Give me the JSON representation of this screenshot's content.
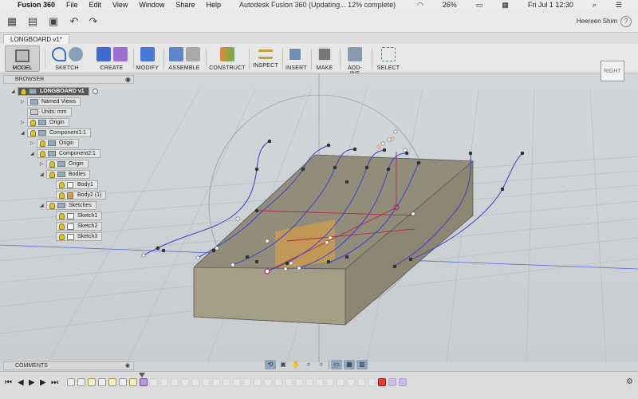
{
  "menubar": {
    "app": "Fusion 360",
    "items": [
      "File",
      "Edit",
      "View",
      "Window",
      "Share",
      "Help"
    ],
    "window_title": "Autodesk Fusion 360  (Updating... 12% complete)",
    "battery": "26%",
    "datetime": "Fri Jul 1  12:30"
  },
  "toolbar": {
    "user": "Heereen Shim"
  },
  "document_tab": "LONGBOARD v1*",
  "ribbon": {
    "workspace": "MODEL",
    "groups": [
      {
        "label": "SKETCH"
      },
      {
        "label": "CREATE"
      },
      {
        "label": "MODIFY"
      },
      {
        "label": "ASSEMBLE"
      },
      {
        "label": "CONSTRUCT"
      },
      {
        "label": "INSPECT"
      },
      {
        "label": "INSERT"
      },
      {
        "label": "MAKE"
      },
      {
        "label": "ADD-INS"
      },
      {
        "label": "SELECT"
      }
    ]
  },
  "viewcube": {
    "face": "RIGHT"
  },
  "browser": {
    "title": "BROWSER",
    "root": "LONGBOARD v1",
    "named_views": "Named Views",
    "units": "Units: mm",
    "origin": "Origin",
    "component1": "Component1:1",
    "c1_origin": "Origin",
    "component2": "Component2:1",
    "c2_origin": "Origin",
    "bodies": "Bodies",
    "body1": "Body1",
    "body2": "Body2 (1)",
    "sketches": "Sketches",
    "sketch1": "Sketch1",
    "sketch2": "Sketch2",
    "sketch3": "Sketch3"
  },
  "comments": {
    "title": "COMMENTS"
  },
  "colors": {
    "body_top": "#8e8875",
    "body_front": "#a59e86",
    "accent_red": "#b0284a",
    "sketch_blue": "#3a44c8"
  }
}
